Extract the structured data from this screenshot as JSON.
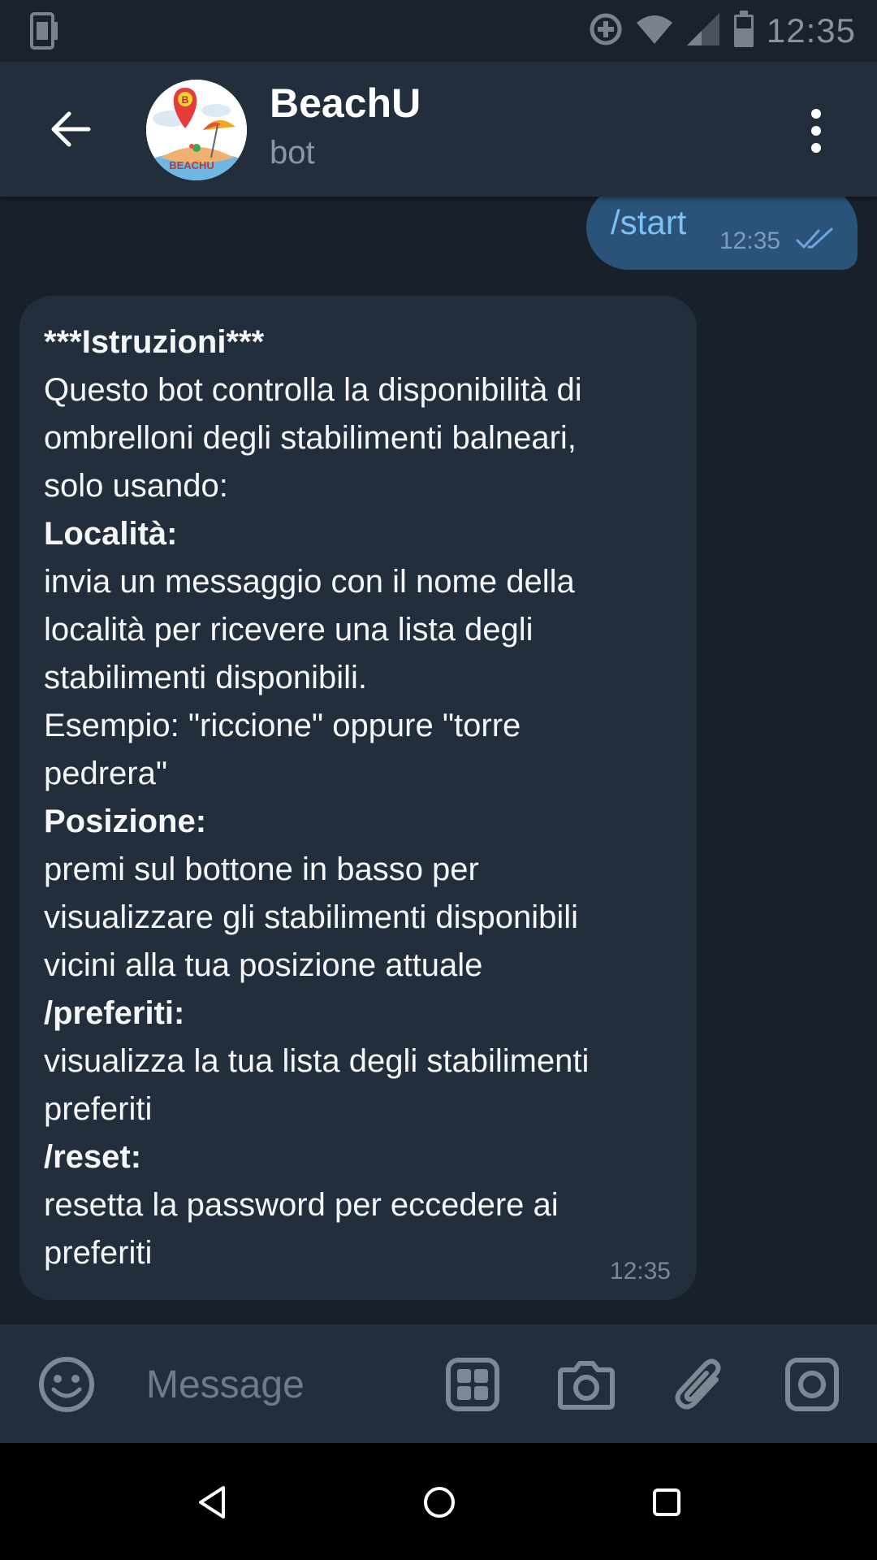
{
  "status_bar": {
    "time": "12:35",
    "icons": [
      "phone-vibrate-icon",
      "data-saver-icon",
      "wifi-icon",
      "signal-icon",
      "battery-icon"
    ]
  },
  "header": {
    "title": "BeachU",
    "subtitle": "bot",
    "avatar_text": "BEACHU",
    "avatar_pin_letter": "B"
  },
  "messages": {
    "outgoing": {
      "text": "/start",
      "time": "12:35"
    },
    "incoming": {
      "time": "12:35",
      "lines": [
        {
          "text": "***Istruzioni***",
          "bold": true
        },
        {
          "text": "Questo bot controlla la disponibilità di",
          "bold": false
        },
        {
          "text": "ombrelloni degli stabilimenti balneari,",
          "bold": false
        },
        {
          "text": "solo usando:",
          "bold": false
        },
        {
          "text": "Località:",
          "bold": true
        },
        {
          "text": "invia un messaggio con il nome della",
          "bold": false
        },
        {
          "text": "località per ricevere una lista degli",
          "bold": false
        },
        {
          "text": "stabilimenti disponibili.",
          "bold": false
        },
        {
          "text": "Esempio: \"riccione\" oppure \"torre",
          "bold": false
        },
        {
          "text": "pedrera\"",
          "bold": false
        },
        {
          "text": "Posizione:",
          "bold": true
        },
        {
          "text": "premi sul bottone in basso per",
          "bold": false
        },
        {
          "text": "visualizzare gli stabilimenti disponibili",
          "bold": false
        },
        {
          "text": "vicini alla tua posizione attuale",
          "bold": false
        },
        {
          "text": "/preferiti:",
          "bold": true
        },
        {
          "text": "visualizza la tua lista degli stabilimenti",
          "bold": false
        },
        {
          "text": "preferiti",
          "bold": false
        },
        {
          "text": "/reset:",
          "bold": true
        },
        {
          "text": "resetta la password per eccedere ai",
          "bold": false
        },
        {
          "text": "preferiti",
          "bold": false
        }
      ]
    }
  },
  "input_bar": {
    "placeholder": "Message",
    "icons": [
      "emoji-icon",
      "bot-commands-icon",
      "camera-icon",
      "attach-icon",
      "instagram-icon"
    ]
  },
  "colors": {
    "background": "#18202b",
    "header": "#232e3c",
    "outgoing_bubble": "#2b5278",
    "incoming_bubble": "#232e3c",
    "link": "#7cc0f5"
  }
}
